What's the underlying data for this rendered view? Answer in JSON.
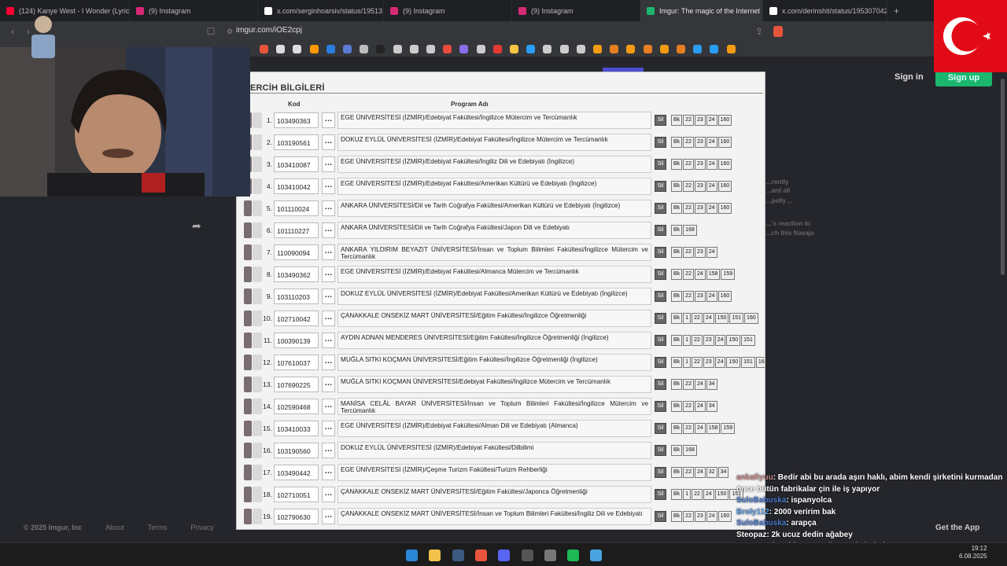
{
  "browser": {
    "tabs": [
      {
        "title": "(124) Kanye West - I Wonder (Lyrics)",
        "color": "#ff0033",
        "active": false
      },
      {
        "title": "(9) Instagram",
        "color": "#d62976",
        "active": false
      },
      {
        "title": "x.com/serginhoarsiv/status/19513",
        "color": "#ffffff",
        "active": false
      },
      {
        "title": "(9) Instagram",
        "color": "#d62976",
        "active": false
      },
      {
        "title": "(9) Instagram",
        "color": "#d62976",
        "active": false
      },
      {
        "title": "Imgur: The magic of the Internet",
        "color": "#1bb76e",
        "active": true
      },
      {
        "title": "x.com/derinshit/status/1953070428",
        "color": "#ffffff",
        "active": false
      }
    ],
    "url": "imgur.com/iOE2cpj"
  },
  "imgur": {
    "sign_in": "Sign in",
    "sign_up": "Sign up",
    "side_texts": [
      "...rently",
      "...ard all",
      "...pelly ...",
      "...'s reaction to",
      "...ch this Navajo"
    ],
    "footer": [
      "© 2025 Imgur, Inc",
      "About",
      "Terms",
      "Privacy",
      "Ru"
    ],
    "get_app": "Get the App"
  },
  "dialog": {
    "title": "ERCİH BİLGİLERİ",
    "col_kod": "Kod",
    "col_program": "Program Adı",
    "delete_label": "Sil",
    "rows": [
      {
        "n": "1.",
        "kod": "103490363",
        "program": "EGE ÜNİVERSİTESİ (İZMİR)/Edebiyat Fakültesi/İngilizce Mütercim ve Tercümanlık",
        "tags": [
          "Bk",
          "22",
          "23",
          "24",
          "160"
        ]
      },
      {
        "n": "2.",
        "kod": "103190561",
        "program": "DOKUZ EYLÜL ÜNİVERSİTESİ (İZMİR)/Edebiyat Fakültesi/İngilizce Mütercim ve Tercümanlık",
        "tags": [
          "Bk",
          "22",
          "23",
          "24",
          "160"
        ]
      },
      {
        "n": "3.",
        "kod": "103410087",
        "program": "EGE ÜNİVERSİTESİ (İZMİR)/Edebiyat Fakültesi/İngiliz Dili ve Edebiyatı (İngilizce)",
        "tags": [
          "Bk",
          "22",
          "23",
          "24",
          "160"
        ]
      },
      {
        "n": "4.",
        "kod": "103410042",
        "program": "EGE ÜNİVERSİTESİ (İZMİR)/Edebiyat Fakültesi/Amerikan Kültürü ve Edebiyatı (İngilizce)",
        "tags": [
          "Bk",
          "22",
          "23",
          "24",
          "160"
        ]
      },
      {
        "n": "5.",
        "kod": "101110024",
        "program": "ANKARA ÜNİVERSİTESİ/Dil ve Tarih Coğrafya Fakültesi/Amerikan Kültürü ve Edebiyatı (İngilizce)",
        "tags": [
          "Bk",
          "22",
          "23",
          "24",
          "160"
        ]
      },
      {
        "n": "6.",
        "kod": "101110227",
        "program": "ANKARA ÜNİVERSİTESİ/Dil ve Tarih Coğrafya Fakültesi/Japon Dili ve Edebiyatı",
        "tags": [
          "Bk",
          "168"
        ]
      },
      {
        "n": "7.",
        "kod": "110090094",
        "program": "ANKARA YILDIRIM BEYAZIT ÜNİVERSİTESİ/İnsan ve Toplum Bilimleri Fakültesi/İngilizce Mütercim ve Tercümanlık",
        "tags": [
          "Bk",
          "22",
          "23",
          "24"
        ]
      },
      {
        "n": "8.",
        "kod": "103490362",
        "program": "EGE ÜNİVERSİTESİ (İZMİR)/Edebiyat Fakültesi/Almanca Mütercim ve Tercümanlık",
        "tags": [
          "Bk",
          "22",
          "24",
          "158",
          "159"
        ]
      },
      {
        "n": "9.",
        "kod": "103110203",
        "program": "DOKUZ EYLÜL ÜNİVERSİTESİ (İZMİR)/Edebiyat Fakültesi/Amerikan Kültürü ve Edebiyatı (İngilizce)",
        "tags": [
          "Bk",
          "22",
          "23",
          "24",
          "160"
        ]
      },
      {
        "n": "10.",
        "kod": "102710042",
        "program": "ÇANAKKALE ONSEKİZ MART ÜNİVERSİTESİ/Eğitim Fakültesi/İngilizce Öğretmenliği",
        "tags": [
          "Bk",
          "1",
          "22",
          "24",
          "150",
          "151",
          "160"
        ]
      },
      {
        "n": "11.",
        "kod": "100390139",
        "program": "AYDIN ADNAN MENDERES ÜNİVERSİTESİ/Eğitim Fakültesi/İngilizce Öğretmenliği (İngilizce)",
        "tags": [
          "Bk",
          "1",
          "22",
          "23",
          "24",
          "150",
          "151"
        ]
      },
      {
        "n": "12.",
        "kod": "107610037",
        "program": "MUĞLA SITKI KOÇMAN ÜNİVERSİTESİ/Eğitim Fakültesi/İngilizce Öğretmenliği (İngilizce)",
        "tags": [
          "Bk",
          "1",
          "22",
          "23",
          "24",
          "150",
          "151",
          "160"
        ]
      },
      {
        "n": "13.",
        "kod": "107690225",
        "program": "MUĞLA SITKI KOÇMAN ÜNİVERSİTESİ/Edebiyat Fakültesi/İngilizce Mütercim ve Tercümanlık",
        "tags": [
          "Bk",
          "22",
          "24",
          "34"
        ]
      },
      {
        "n": "14.",
        "kod": "102590468",
        "program": "MANİSA CELÂL BAYAR ÜNİVERSİTESİ/İnsan ve Toplum Bilimleri Fakültesi/İngilizce Mütercim ve Tercümanlık",
        "tags": [
          "Bk",
          "22",
          "24",
          "34"
        ]
      },
      {
        "n": "15.",
        "kod": "103410033",
        "program": "EGE ÜNİVERSİTESİ (İZMİR)/Edebiyat Fakültesi/Alman Dili ve Edebiyatı (Almanca)",
        "tags": [
          "Bk",
          "22",
          "24",
          "158",
          "159"
        ]
      },
      {
        "n": "16.",
        "kod": "103190560",
        "program": "DOKUZ EYLÜL ÜNİVERSİTESİ (İZMİR)/Edebiyat Fakültesi/Dilbilimi",
        "tags": [
          "Bk",
          "168"
        ]
      },
      {
        "n": "17.",
        "kod": "103490442",
        "program": "EGE ÜNİVERSİTESİ (İZMİR)/Çeşme Turizm Fakültesi/Turizm Rehberliği",
        "tags": [
          "Bk",
          "22",
          "24",
          "32",
          "34"
        ]
      },
      {
        "n": "18.",
        "kod": "102710051",
        "program": "ÇANAKKALE ONSEKİZ MART ÜNİVERSİTESİ/Eğitim Fakültesi/Japonca Öğretmenliği",
        "tags": [
          "Bk",
          "1",
          "22",
          "24",
          "150",
          "151"
        ]
      },
      {
        "n": "19.",
        "kod": "102790630",
        "program": "ÇANAKKALE ONSEKİZ MART ÜNİVERSİTESİ/İnsan ve Toplum Bilimleri Fakültesi/İngiliz Dili ve Edebiyatı",
        "tags": [
          "Bk",
          "22",
          "23",
          "24",
          "160"
        ]
      }
    ]
  },
  "chat": [
    {
      "user": "ankafiyuu",
      "color": "#c98a8a",
      "text": ": Bedir abi bu arada aşırı haklı, abim kendi şirketini kurmadan",
      "cont": "önce bütün fabrikalar çin ile iş yapıyor"
    },
    {
      "user": "SuloBabuska",
      "color": "#4a7bd0",
      "text": ": ispanyolca"
    },
    {
      "user": "Broly112",
      "color": "#5aa0e8",
      "text": ": 2000 veririm bak"
    },
    {
      "user": "SuloBabuska",
      "color": "#4a7bd0",
      "text": ": arapça"
    },
    {
      "user": "Steopaz",
      "color": "#ffffff",
      "text": ": 2k ucuz dedin ağabey"
    },
    {
      "user": "ZOT4",
      "color": "#ffffff",
      "text": ": 2 yi veririm ama öğreteceksin bak"
    }
  ],
  "clock": {
    "time": "19:12",
    "date": "6.08.2025"
  }
}
